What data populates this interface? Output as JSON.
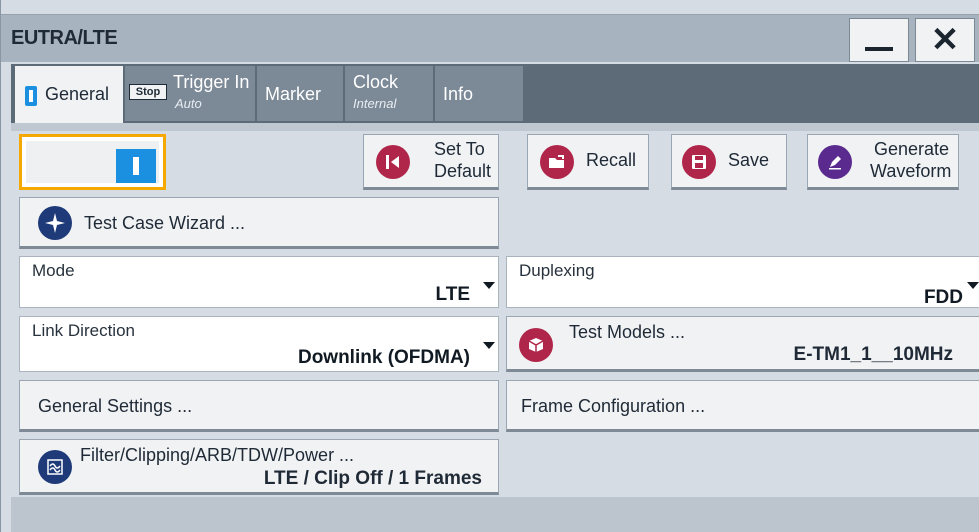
{
  "window": {
    "title": "EUTRA/LTE",
    "minimize_icon": "minimize-icon",
    "close_icon": "close-icon"
  },
  "tabs": [
    {
      "label": "General",
      "sub": "",
      "active": true
    },
    {
      "label": "Trigger In",
      "sub": "Auto",
      "badge": "Stop"
    },
    {
      "label": "Marker",
      "sub": ""
    },
    {
      "label": "Clock",
      "sub": "Internal"
    },
    {
      "label": "Info",
      "sub": ""
    }
  ],
  "toolbar": {
    "state": "On",
    "set_to_default": [
      "Set To",
      "Default"
    ],
    "recall": "Recall",
    "save": "Save",
    "generate": [
      "Generate",
      "Waveform"
    ]
  },
  "test_case_wizard": "Test Case Wizard ...",
  "mode": {
    "label": "Mode",
    "value": "LTE"
  },
  "duplexing": {
    "label": "Duplexing",
    "value": "FDD"
  },
  "link_direction": {
    "label": "Link Direction",
    "value": "Downlink (OFDMA)"
  },
  "test_models": {
    "label": "Test Models ...",
    "value": "E-TM1_1__10MHz"
  },
  "general_settings": "General Settings ...",
  "frame_configuration": "Frame Configuration ...",
  "filter": {
    "label": "Filter/Clipping/ARB/TDW/Power ...",
    "value": "LTE / Clip Off / 1 Frames"
  },
  "colors": {
    "accent_blue": "#1b8fe0",
    "icon_red": "#b0264a",
    "icon_purple": "#5a2a8e",
    "icon_navy": "#1e3a78",
    "highlight": "#f5a800"
  }
}
